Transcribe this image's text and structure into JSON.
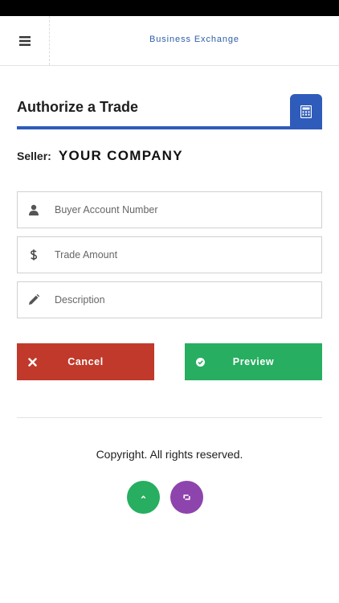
{
  "header": {
    "title": "Business Exchange",
    "menu_icon": "hamburger-menu-icon"
  },
  "section": {
    "title": "Authorize a Trade",
    "calculator_icon": "calculator-icon",
    "accent_color": "#2f5cba"
  },
  "seller": {
    "label": "Seller:",
    "value": "YOUR COMPANY"
  },
  "form": {
    "buyer_account": {
      "placeholder": "Buyer Account Number",
      "value": "",
      "icon": "user-icon"
    },
    "trade_amount": {
      "placeholder": "Trade Amount",
      "value": "",
      "icon": "dollar-icon"
    },
    "description": {
      "placeholder": "Description",
      "value": "",
      "icon": "pencil-icon"
    }
  },
  "actions": {
    "cancel_label": "Cancel",
    "cancel_icon": "close-icon",
    "cancel_color": "#c0392b",
    "preview_label": "Preview",
    "preview_icon": "check-circle-icon",
    "preview_color": "#27ae60"
  },
  "footer": {
    "copyright": "Copyright. All rights reserved.",
    "scroll_top_icon": "chevron-up-icon",
    "scroll_top_color": "#27ae60",
    "refresh_icon": "retweet-icon",
    "refresh_color": "#8e44ad"
  }
}
